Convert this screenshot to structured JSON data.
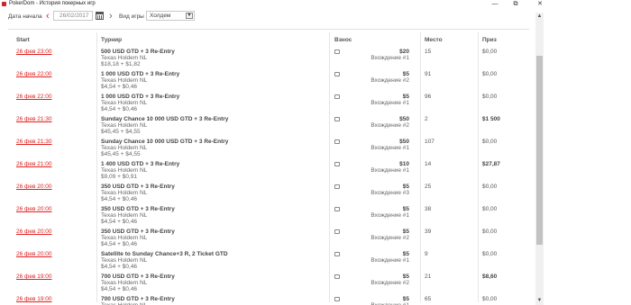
{
  "window": {
    "title": "PokerDom - История покерных игр",
    "minimize": "—",
    "maximize": "⧉",
    "close": "✕"
  },
  "filters": {
    "date_label": "Дата начала",
    "date_value": "26/02/2017",
    "prev_arrow": "‹",
    "next_arrow": "›",
    "game_label": "Вид игры",
    "game_value": "Холдем",
    "select_arrow": "▼"
  },
  "columns": {
    "start": "Start",
    "tournament": "Турнир",
    "buyin": "Взнос",
    "place": "Место",
    "prize": "Приз"
  },
  "rows": [
    {
      "start": "26 фев 23:00",
      "name": "500 USD GTD + 3 Re-Entry",
      "game": "Texas Holdem NL",
      "cost": "$18,18 + $1,82",
      "buyin": "$20",
      "entry": "Вхождение #1",
      "place": "15",
      "prize": "$0,00",
      "win": false
    },
    {
      "start": "26 фев 22:00",
      "name": "1 000 USD GTD + 3 Re-Entry",
      "game": "Texas Holdem NL",
      "cost": "$4,54 + $0,46",
      "buyin": "$5",
      "entry": "Вхождение #2",
      "place": "91",
      "prize": "$0,00",
      "win": false
    },
    {
      "start": "26 фев 22:00",
      "name": "1 000 USD GTD + 3 Re-Entry",
      "game": "Texas Holdem NL",
      "cost": "$4,54 + $0,46",
      "buyin": "$5",
      "entry": "Вхождение #1",
      "place": "96",
      "prize": "$0,00",
      "win": false
    },
    {
      "start": "26 фев 21:30",
      "name": "Sunday Chance 10 000 USD GTD + 3 Re-Entry",
      "game": "Texas Holdem NL",
      "cost": "$45,45 + $4,55",
      "buyin": "$50",
      "entry": "Вхождение #2",
      "place": "2",
      "prize": "$1 500",
      "win": true
    },
    {
      "start": "26 фев 21:30",
      "name": "Sunday Chance 10 000 USD GTD + 3 Re-Entry",
      "game": "Texas Holdem NL",
      "cost": "$45,45 + $4,55",
      "buyin": "$50",
      "entry": "Вхождение #1",
      "place": "107",
      "prize": "$0,00",
      "win": false
    },
    {
      "start": "26 фев 21:00",
      "name": "1 400 USD GTD + 3 Re-Entry",
      "game": "Texas Holdem NL",
      "cost": "$9,09 + $0,91",
      "buyin": "$10",
      "entry": "Вхождение #1",
      "place": "14",
      "prize": "$27,87",
      "win": true
    },
    {
      "start": "26 фев 20:00",
      "name": "350 USD GTD + 3 Re-Entry",
      "game": "Texas Holdem NL",
      "cost": "$4,54 + $0,46",
      "buyin": "$5",
      "entry": "Вхождение #3",
      "place": "25",
      "prize": "$0,00",
      "win": false
    },
    {
      "start": "26 фев 20:00",
      "name": "350 USD GTD + 3 Re-Entry",
      "game": "Texas Holdem NL",
      "cost": "$4,54 + $0,46",
      "buyin": "$5",
      "entry": "Вхождение #1",
      "place": "38",
      "prize": "$0,00",
      "win": false
    },
    {
      "start": "26 фев 20:00",
      "name": "350 USD GTD + 3 Re-Entry",
      "game": "Texas Holdem NL",
      "cost": "$4,54 + $0,46",
      "buyin": "$5",
      "entry": "Вхождение #2",
      "place": "39",
      "prize": "$0,00",
      "win": false
    },
    {
      "start": "26 фев 20:00",
      "name": "Satellite to Sunday Chance+3 R, 2 Ticket GTD",
      "game": "Texas Holdem NL",
      "cost": "$4,54 + $0,46",
      "buyin": "$5",
      "entry": "Вхождение #1",
      "place": "9",
      "prize": "$0,00",
      "win": false
    },
    {
      "start": "26 фев 19:00",
      "name": "700 USD GTD + 3 Re-Entry",
      "game": "Texas Holdem NL",
      "cost": "$4,54 + $0,46",
      "buyin": "$5",
      "entry": "Вхождение #2",
      "place": "21",
      "prize": "$8,60",
      "win": true
    },
    {
      "start": "26 фев 19:00",
      "name": "700 USD GTD + 3 Re-Entry",
      "game": "Texas Holdem NL",
      "cost": "$4,54 + $0,46",
      "buyin": "$5",
      "entry": "Вхождение #1",
      "place": "65",
      "prize": "$0,00",
      "win": false
    }
  ],
  "scrollbar": {
    "up": "▲",
    "down": "▼"
  },
  "colors": {
    "link": "#e02020",
    "accent": "#c8262b"
  }
}
